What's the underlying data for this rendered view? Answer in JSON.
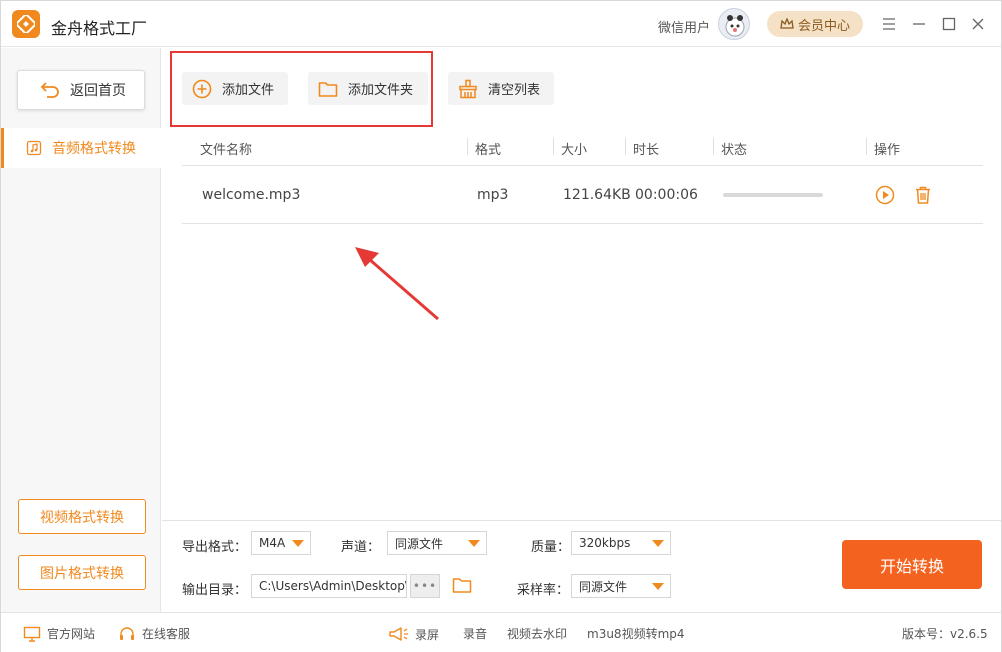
{
  "app": {
    "title": "金舟格式工厂"
  },
  "header": {
    "user_name": "微信用户",
    "vip_label": "会员中心"
  },
  "sidebar": {
    "back_label": "返回首页",
    "active_item": "音频格式转换",
    "video_label": "视频格式转换",
    "image_label": "图片格式转换"
  },
  "toolbar": {
    "add_file": "添加文件",
    "add_folder": "添加文件夹",
    "clear_list": "清空列表"
  },
  "table": {
    "headers": [
      "文件名称",
      "格式",
      "大小",
      "时长",
      "状态",
      "操作"
    ],
    "rows": [
      {
        "name": "welcome.mp3",
        "format": "mp3",
        "size": "121.64KB",
        "duration": "00:00:06",
        "progress": 0
      }
    ]
  },
  "settings": {
    "format_label": "导出格式：",
    "format_value": "M4A",
    "channel_label": "声道：",
    "channel_value": "同源文件",
    "quality_label": "质量：",
    "quality_value": "320kbps",
    "output_label": "输出目录：",
    "output_value": "C:\\Users\\Admin\\Desktop\\",
    "dots": "•••",
    "samplerate_label": "采样率：",
    "samplerate_value": "同源文件",
    "start_label": "开始转换"
  },
  "statusbar": {
    "website": "官方网站",
    "service": "在线客服",
    "record_screen": "录屏",
    "record_audio": "录音",
    "watermark": "视频去水印",
    "m3u8": "m3u8视频转mp4",
    "version": "版本号：v2.6.5"
  },
  "colors": {
    "accent": "#f08a1e",
    "start": "#f4621f",
    "highlight": "#e53935"
  }
}
